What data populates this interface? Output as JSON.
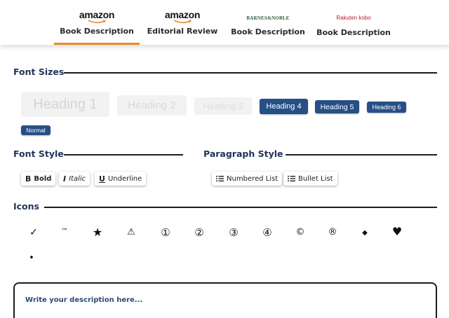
{
  "tabs": [
    {
      "logo": "amazon",
      "label": "Book Description",
      "active": true
    },
    {
      "logo": "amazon",
      "label": "Editorial Review",
      "active": false
    },
    {
      "logo": "BARNES&NOBLE",
      "label": "Book Description",
      "active": false
    },
    {
      "logo": "Rakuten kobo",
      "label": "Book Description",
      "active": false
    }
  ],
  "font_sizes": {
    "title": "Font Sizes",
    "options": [
      "Heading 1",
      "Heading 2",
      "Heading 3",
      "Heading 4",
      "Heading 5",
      "Heading 6",
      "Normal"
    ]
  },
  "font_style": {
    "title": "Font Style",
    "bold": {
      "icon": "B",
      "label": "Bold"
    },
    "italic": {
      "icon": "I",
      "label": "Italic"
    },
    "underline": {
      "icon": "U",
      "label": "Underline"
    }
  },
  "paragraph_style": {
    "title": "Paragraph Style",
    "numbered": {
      "icon": "list-numbered-icon",
      "label": "Numbered List"
    },
    "bullet": {
      "icon": "list-bullet-icon",
      "label": "Bullet List"
    }
  },
  "icons": {
    "title": "Icons",
    "glyphs": [
      "✓",
      "™",
      "★",
      "⚠",
      "①",
      "②",
      "③",
      "④",
      "©",
      "®",
      "◆",
      "♥",
      "•"
    ]
  },
  "editor": {
    "placeholder": "Write your description here..."
  },
  "colors": {
    "accent_underline": "#e38b2c",
    "pill_dark": "#264f86",
    "pill_light": "#f2f2f2",
    "heading_text": "#1f3457"
  }
}
